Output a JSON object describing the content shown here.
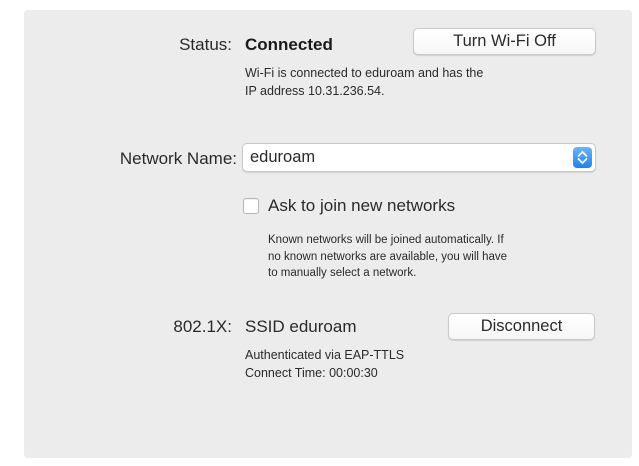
{
  "status": {
    "label": "Status:",
    "value": "Connected",
    "button_label": "Turn Wi-Fi Off",
    "description_line1": "Wi-Fi is connected to eduroam and has the",
    "description_line2": "IP address 10.31.236.54."
  },
  "network": {
    "label": "Network Name:",
    "selected": "eduroam",
    "stepper_icon": "chevron-up-down-icon"
  },
  "ask_join": {
    "label": "Ask to join new networks",
    "checked": false,
    "note_line1": "Known networks will be joined automatically. If",
    "note_line2": "no known networks are available, you will have",
    "note_line3": "to manually select a network."
  },
  "dot1x": {
    "label": "802.1X:",
    "ssid": "SSID eduroam",
    "button_label": "Disconnect",
    "auth_line": "Authenticated via EAP-TTLS",
    "connect_time": "Connect Time: 00:00:30"
  },
  "colors": {
    "panel_bg": "#ececec",
    "accent": "#1a82fb"
  }
}
